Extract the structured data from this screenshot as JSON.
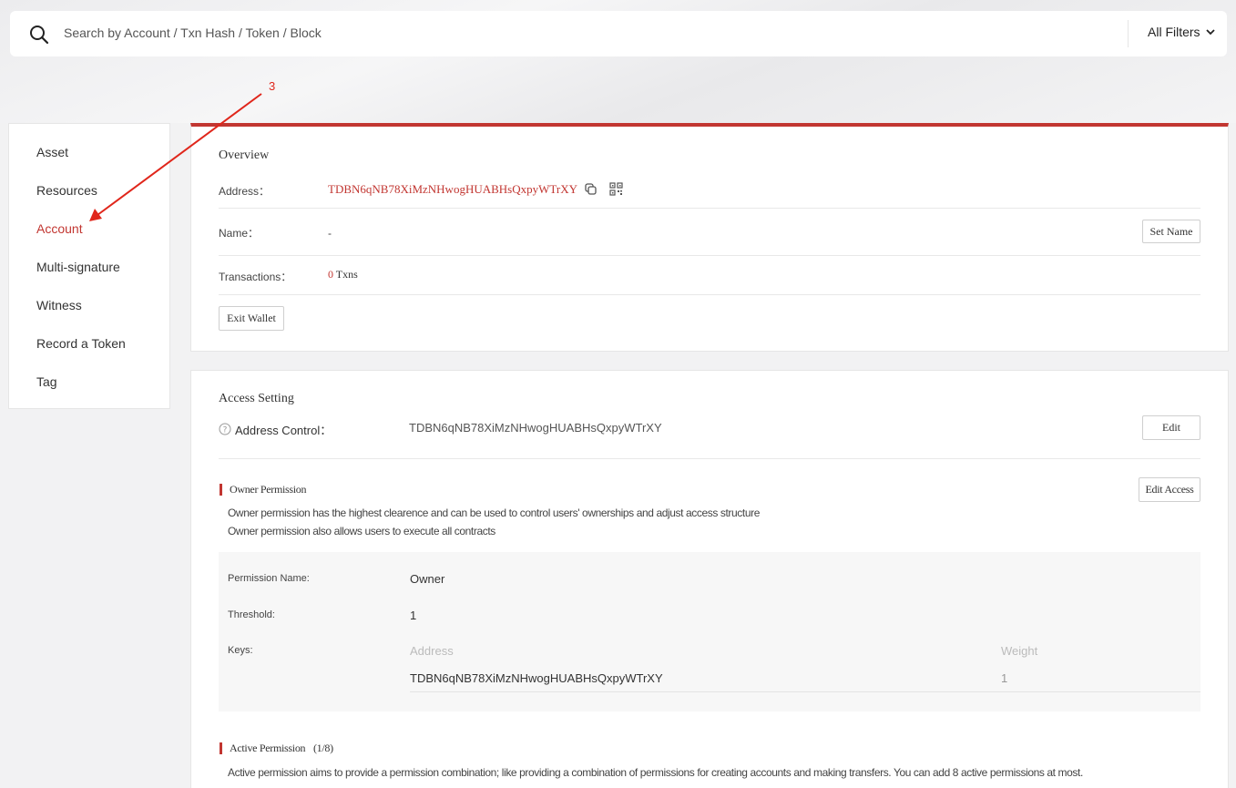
{
  "search": {
    "placeholder": "Search by Account / Txn Hash / Token / Block",
    "filter_label": "All Filters"
  },
  "annotation": {
    "label": "3"
  },
  "sidebar": {
    "items": [
      {
        "label": "Asset"
      },
      {
        "label": "Resources"
      },
      {
        "label": "Account"
      },
      {
        "label": "Multi-signature"
      },
      {
        "label": "Witness"
      },
      {
        "label": "Record a Token"
      },
      {
        "label": "Tag"
      }
    ],
    "active": "Account"
  },
  "overview": {
    "title": "Overview",
    "address_label": "Address：",
    "address_value": "TDBN6qNB78XiMzNHwogHUABHsQxpyWTrXY",
    "name_label": "Name：",
    "name_value": "-",
    "set_name_button": "Set Name",
    "transactions_label": "Transactions：",
    "transactions_count": "0",
    "transactions_unit": "Txns",
    "exit_wallet_button": "Exit Wallet"
  },
  "access": {
    "title": "Access Setting",
    "help_icon": "question-icon",
    "address_control_label": "Address Control：",
    "address_control_value": "TDBN6qNB78XiMzNHwogHUABHsQxpyWTrXY",
    "edit_button": "Edit",
    "owner": {
      "title": "Owner Permission",
      "edit_access_button": "Edit Access",
      "desc_line1": "Owner permission has the highest clearence and can be used to control users' ownerships and adjust access structure",
      "desc_line2": "Owner permission also allows users to execute all contracts",
      "permission_name_label": "Permission Name:",
      "permission_name_value": "Owner",
      "threshold_label": "Threshold:",
      "threshold_value": "1",
      "keys_label": "Keys:",
      "keys_header_address": "Address",
      "keys_header_weight": "Weight",
      "keys": [
        {
          "address": "TDBN6qNB78XiMzNHwogHUABHsQxpyWTrXY",
          "weight": "1"
        }
      ]
    },
    "active": {
      "title": "Active Permission",
      "count": "(1/8)",
      "desc": "Active permission aims to provide a permission combination; like providing a combination of permissions for creating accounts and making transfers. You can add 8 active permissions at most."
    }
  },
  "colors": {
    "accent": "#c23631",
    "annotation": "#e0261b"
  }
}
